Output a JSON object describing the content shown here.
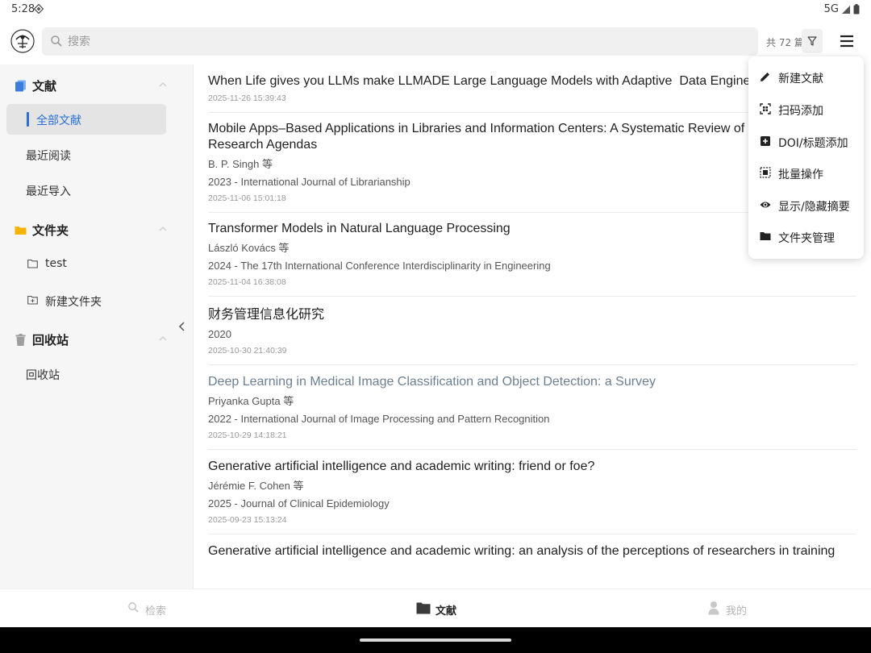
{
  "status_bar": {
    "time": "5:28",
    "network": "5G"
  },
  "header": {
    "search": {
      "placeholder": "搜索"
    },
    "count_text": "共 72 篇"
  },
  "sidebar": {
    "sections": [
      {
        "title": "文献",
        "icon": "document-stack-icon",
        "color": "#3b7ddd",
        "items": [
          "全部文献",
          "最近阅读",
          "最近导入"
        ],
        "active_item": "全部文献"
      },
      {
        "title": "文件夹",
        "icon": "folder-icon",
        "color": "#f5b400",
        "items": [
          "test",
          "新建文件夹"
        ]
      },
      {
        "title": "回收站",
        "icon": "trash-icon",
        "color": "#9e9e9e",
        "items": [
          "回收站"
        ]
      }
    ]
  },
  "documents": [
    {
      "title": "When Life gives you LLMs make LLMADE Large Language Models with Adaptive  Data Engineering",
      "authors": "",
      "source": "",
      "added": "2025-11-26 15:39:43",
      "read": false
    },
    {
      "title": "Mobile Apps–Based Applications in Libraries and Information Centers: A Systematic Review of the Liter\nResearch Agendas",
      "authors": "B. P. Singh 等",
      "source": "2023 - International Journal of Librarianship",
      "added": "2025-11-06 15:01:18",
      "read": false
    },
    {
      "title": "Transformer Models in Natural Language Processing",
      "authors": "László Kovács 等",
      "source": "2024 - The 17th International Conference Interdisciplinarity in Engineering",
      "added": "2025-11-04 16:38:08",
      "read": false
    },
    {
      "title": "财务管理信息化研究",
      "authors": "",
      "source": "2020",
      "added": "2025-10-30 21:40:39",
      "read": false
    },
    {
      "title": "Deep Learning in Medical Image Classification and Object Detection: a Survey",
      "authors": "Priyanka Gupta 等",
      "source": "2022 - International Journal of Image Processing and Pattern Recognition",
      "added": "2025-10-29 14:18:21",
      "read": true
    },
    {
      "title": "Generative artificial intelligence and academic writing: friend or foe?",
      "authors": "Jérémie F. Cohen 等",
      "source": "2025 - Journal of Clinical Epidemiology",
      "added": "2025-09-23 15:13:24",
      "read": false
    },
    {
      "title": "Generative artificial intelligence and academic writing: an analysis of the perceptions of researchers in training",
      "authors": "",
      "source": "",
      "added": "",
      "read": false
    }
  ],
  "popup_menu": {
    "items": [
      {
        "label": "新建文献",
        "icon": "pencil-icon"
      },
      {
        "label": "扫码添加",
        "icon": "qr-scan-icon"
      },
      {
        "label": "DOI/标题添加",
        "icon": "add-box-icon"
      },
      {
        "label": "批量操作",
        "icon": "select-all-icon"
      },
      {
        "label": "显示/隐藏摘要",
        "icon": "eye-icon"
      },
      {
        "label": "文件夹管理",
        "icon": "folder-icon"
      }
    ]
  },
  "bottom_nav": {
    "items": [
      {
        "label": "检索",
        "icon": "search-icon"
      },
      {
        "label": "文献",
        "icon": "folder-icon"
      },
      {
        "label": "我的",
        "icon": "person-icon"
      }
    ],
    "active_index": 1
  },
  "colors": {
    "accent": "#2a6fd6",
    "read_title": "#6c7f92"
  }
}
